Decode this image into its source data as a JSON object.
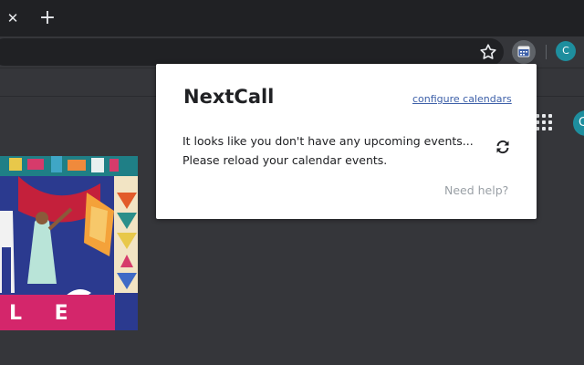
{
  "browser": {
    "tab_close_glyph": "✕",
    "new_tab_glyph": "+",
    "profile_initial": "C",
    "account_initial": "C"
  },
  "doodle": {
    "visible_letters": "L E"
  },
  "popup": {
    "title": "NextCall",
    "configure_link": "configure calendars",
    "message_line1": "It looks like you don't have any upcoming events...",
    "message_line2": "Please reload your calendar events.",
    "help_link": "Need help?"
  },
  "icons": {
    "bookmark": "star-icon",
    "extension": "calendar-icon",
    "apps": "apps-grid-icon",
    "reload": "reload-icon"
  },
  "colors": {
    "tabstrip_bg": "#202124",
    "toolbar_bg": "#35363a",
    "popup_bg": "#ffffff",
    "link": "#3c5fa8",
    "profile": "#1e8e9e"
  }
}
